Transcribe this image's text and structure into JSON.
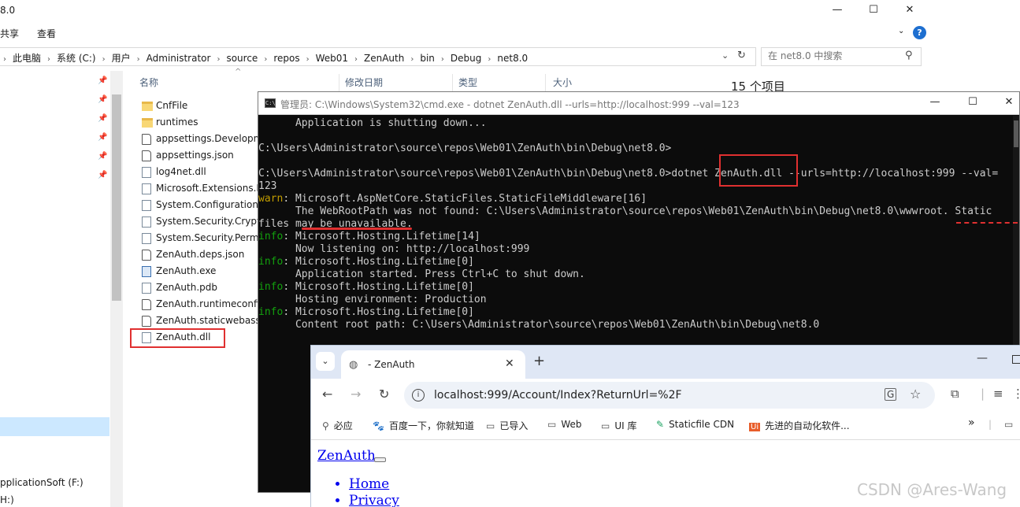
{
  "explorer": {
    "title_fragment": "8.0",
    "ribbon": {
      "share": "共享",
      "view": "查看"
    },
    "breadcrumbs": [
      "此电脑",
      "系统 (C:)",
      "用户",
      "Administrator",
      "source",
      "repos",
      "Web01",
      "ZenAuth",
      "bin",
      "Debug",
      "net8.0"
    ],
    "search_placeholder": "在 net8.0 中搜索",
    "columns": {
      "name": "名称",
      "modified": "修改日期",
      "type": "类型",
      "size": "大小"
    },
    "item_count": "15 个项目",
    "files": [
      {
        "name": "CnfFile",
        "kind": "folder"
      },
      {
        "name": "runtimes",
        "kind": "folder"
      },
      {
        "name": "appsettings.Developm",
        "kind": "json"
      },
      {
        "name": "appsettings.json",
        "kind": "json"
      },
      {
        "name": "log4net.dll",
        "kind": "file"
      },
      {
        "name": "Microsoft.Extensions.L",
        "kind": "file"
      },
      {
        "name": "System.Configuration.C",
        "kind": "file"
      },
      {
        "name": "System.Security.Crypto",
        "kind": "file"
      },
      {
        "name": "System.Security.Permis",
        "kind": "file"
      },
      {
        "name": "ZenAuth.deps.json",
        "kind": "json"
      },
      {
        "name": "ZenAuth.exe",
        "kind": "exe"
      },
      {
        "name": "ZenAuth.pdb",
        "kind": "file"
      },
      {
        "name": "ZenAuth.runtimeconfig",
        "kind": "json"
      },
      {
        "name": "ZenAuth.staticwebasse",
        "kind": "json"
      },
      {
        "name": "ZenAuth.dll",
        "kind": "file"
      }
    ],
    "drive_f": "pplicationSoft (F:)",
    "drive_h": "H:)"
  },
  "cmd": {
    "title": "管理员: C:\\Windows\\System32\\cmd.exe - dotnet  ZenAuth.dll --urls=http://localhost:999 --val=123",
    "lines": [
      {
        "prefix": "",
        "text": "      Application is shutting down..."
      },
      {
        "prefix": "",
        "text": ""
      },
      {
        "prefix": "",
        "text": "C:\\Users\\Administrator\\source\\repos\\Web01\\ZenAuth\\bin\\Debug\\net8.0>"
      },
      {
        "prefix": "",
        "text": ""
      },
      {
        "prefix": "",
        "text": "C:\\Users\\Administrator\\source\\repos\\Web01\\ZenAuth\\bin\\Debug\\net8.0>dotnet ZenAuth.dll --urls=http://localhost:999 --val="
      },
      {
        "prefix": "",
        "text": "123"
      },
      {
        "prefix": "warn",
        "text": ": Microsoft.AspNetCore.StaticFiles.StaticFileMiddleware[16]"
      },
      {
        "prefix": "",
        "text": "      The WebRootPath was not found: C:\\Users\\Administrator\\source\\repos\\Web01\\ZenAuth\\bin\\Debug\\net8.0\\wwwroot. Static"
      },
      {
        "prefix": "",
        "text": "files may be unavailable."
      },
      {
        "prefix": "info",
        "text": ": Microsoft.Hosting.Lifetime[14]"
      },
      {
        "prefix": "",
        "text": "      Now listening on: http://localhost:999"
      },
      {
        "prefix": "info",
        "text": ": Microsoft.Hosting.Lifetime[0]"
      },
      {
        "prefix": "",
        "text": "      Application started. Press Ctrl+C to shut down."
      },
      {
        "prefix": "info",
        "text": ": Microsoft.Hosting.Lifetime[0]"
      },
      {
        "prefix": "",
        "text": "      Hosting environment: Production"
      },
      {
        "prefix": "info",
        "text": ": Microsoft.Hosting.Lifetime[0]"
      },
      {
        "prefix": "",
        "text": "      Content root path: C:\\Users\\Administrator\\source\\repos\\Web01\\ZenAuth\\bin\\Debug\\net8.0"
      }
    ]
  },
  "browser": {
    "tab_title": "- ZenAuth",
    "url": "localhost:999/Account/Index?ReturnUrl=%2F",
    "bookmarks": [
      "必应",
      "百度一下，你就知道",
      "已导入",
      "Web",
      "UI 库",
      "Staticfile CDN",
      "先进的自动化软件..."
    ],
    "page": {
      "brand": "ZenAuth",
      "nav": [
        "Home",
        "Privacy"
      ]
    }
  },
  "watermark": "CSDN @Ares-Wang",
  "colors": {
    "highlight_box": "#e03030",
    "cmd_bg": "#0c0c0c",
    "info": "#13a10e",
    "warn": "#c19c00",
    "link": "#0000ee"
  }
}
